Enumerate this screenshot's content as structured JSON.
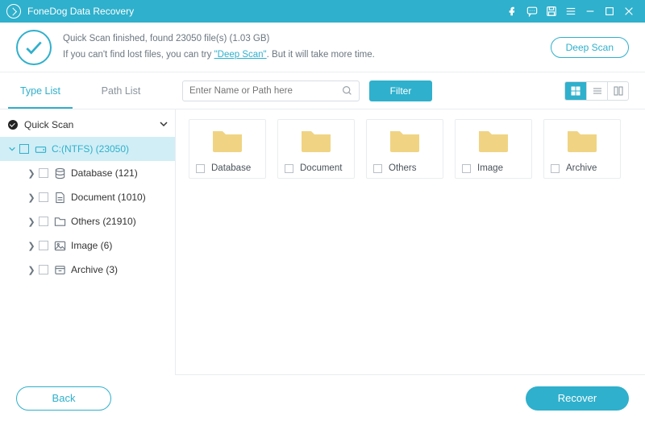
{
  "app": {
    "title": "FoneDog Data Recovery"
  },
  "banner": {
    "line1_prefix": "Quick Scan finished, found ",
    "file_count": "23050",
    "line1_mid": " file(s) (",
    "size": "1.03 GB",
    "line1_suffix": ")",
    "line2_prefix": "If you can't find lost files, you can try ",
    "deep_scan_link": "\"Deep Scan\"",
    "line2_suffix": ". But it will take more time.",
    "deep_scan_btn": "Deep Scan"
  },
  "toolbar": {
    "tab_type": "Type List",
    "tab_path": "Path List",
    "search_placeholder": "Enter Name or Path here",
    "filter": "Filter"
  },
  "tree": {
    "root": "Quick Scan",
    "drive": "C:(NTFS) (23050)",
    "items": [
      {
        "label": "Database (121)"
      },
      {
        "label": "Document (1010)"
      },
      {
        "label": "Others (21910)"
      },
      {
        "label": "Image (6)"
      },
      {
        "label": "Archive (3)"
      }
    ]
  },
  "tiles": [
    {
      "name": "Database"
    },
    {
      "name": "Document"
    },
    {
      "name": "Others"
    },
    {
      "name": "Image"
    },
    {
      "name": "Archive"
    }
  ],
  "footer": {
    "back": "Back",
    "recover": "Recover"
  }
}
